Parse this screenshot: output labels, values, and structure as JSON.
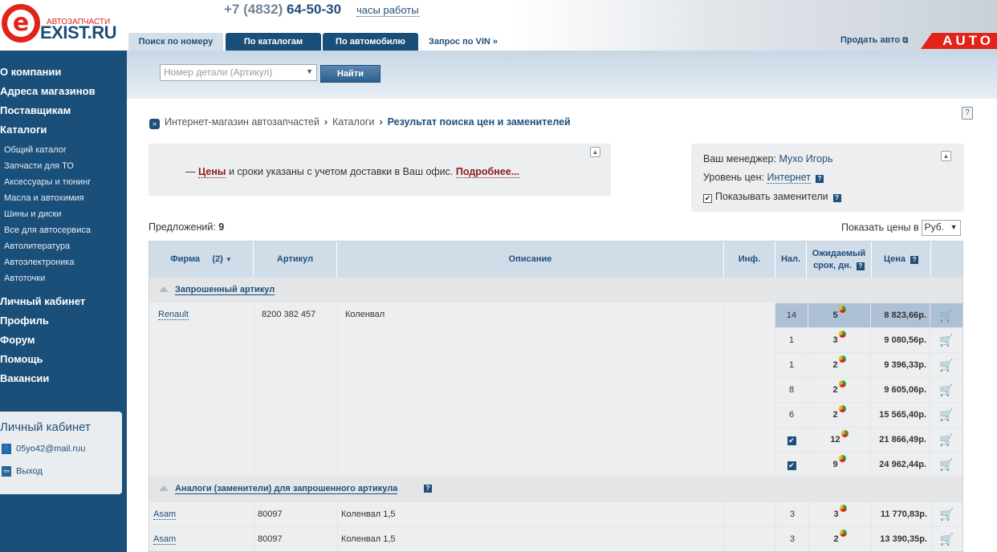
{
  "header": {
    "logo_small": "АВТОЗАПЧАСТИ",
    "logo_big": "EXIST.RU",
    "logo_letter": "e",
    "phone_prefix": "+7 (4832)",
    "phone_number": "64-50-30",
    "hours_link": "часы работы",
    "tabs": [
      "Поиск по номеру",
      "По каталогам",
      "По автомобилю",
      "Запрос по VIN »"
    ],
    "sell_car": "Продать авто",
    "auto_badge": "AUTO"
  },
  "sidebar": {
    "main_top": [
      "О компании",
      "Адреса магазинов",
      "Поставщикам",
      "Каталоги"
    ],
    "sub": [
      "Общий каталог",
      "Запчасти для ТО",
      "Аксессуары и тюнинг",
      "Масла и автохимия",
      "Шины и диски",
      "Все для автосервиса",
      "Автолитература",
      "Автоэлектроника",
      "Автоточки"
    ],
    "main_bottom": [
      "Личный кабинет",
      "Профиль",
      "Форум",
      "Помощь",
      "Вакансии"
    ],
    "lk_title": "Личный кабинет",
    "lk_email": "05yo42@mail.ruu",
    "lk_logout": "Выход"
  },
  "search": {
    "placeholder": "Номер детали (Артикул)",
    "button": "Найти"
  },
  "breadcrumb": {
    "items": [
      "Интернет-магазин автозапчастей",
      "Каталоги"
    ],
    "current": "Результат поиска цен и заменителей"
  },
  "notice": {
    "dash": "—",
    "word": "Цены",
    "text": "и сроки указаны с учетом доставки в Ваш офис.",
    "more": "Подробнее..."
  },
  "manager": {
    "label": "Ваш менеджер:",
    "name": "Мухо Игорь",
    "level_label": "Уровень цен:",
    "level": "Интернет",
    "show_substitutes": "Показывать заменители"
  },
  "offers": {
    "label": "Предложений:",
    "count": "9",
    "show_prices": "Показать цены в",
    "currency": "Руб."
  },
  "table": {
    "headers": {
      "firm": "Фирма",
      "firm_count": "(2)",
      "article": "Артикул",
      "description": "Описание",
      "info": "Инф.",
      "stock": "Нал.",
      "expected1": "Ожидаемый",
      "expected2": "срок, дн.",
      "price": "Цена"
    },
    "group1": "Запрошенный артикул",
    "group2": "Аналоги (заменители) для запрошенного артикула",
    "requested": {
      "firm": "Renault",
      "article": "8200 382 457",
      "description": "Коленвал",
      "offers": [
        {
          "stock": "14",
          "days": "5",
          "price": "8 823,66р."
        },
        {
          "stock": "1",
          "days": "3",
          "price": "9 080,56р."
        },
        {
          "stock": "1",
          "days": "2",
          "price": "9 396,33р."
        },
        {
          "stock": "8",
          "days": "2",
          "price": "9 605,06р."
        },
        {
          "stock": "6",
          "days": "2",
          "price": "15 565,40р."
        },
        {
          "stock": "",
          "days": "12",
          "price": "21 866,49р."
        },
        {
          "stock": "",
          "days": "9",
          "price": "24 962,44р."
        }
      ]
    },
    "analogs": [
      {
        "firm": "Asam",
        "article": "80097",
        "description": "Коленвал 1,5",
        "stock": "3",
        "days": "3",
        "price": "11 770,83р."
      },
      {
        "firm": "Asam",
        "article": "80097",
        "description": "Коленвал 1,5",
        "stock": "3",
        "days": "2",
        "price": "13 390,35р."
      }
    ]
  }
}
